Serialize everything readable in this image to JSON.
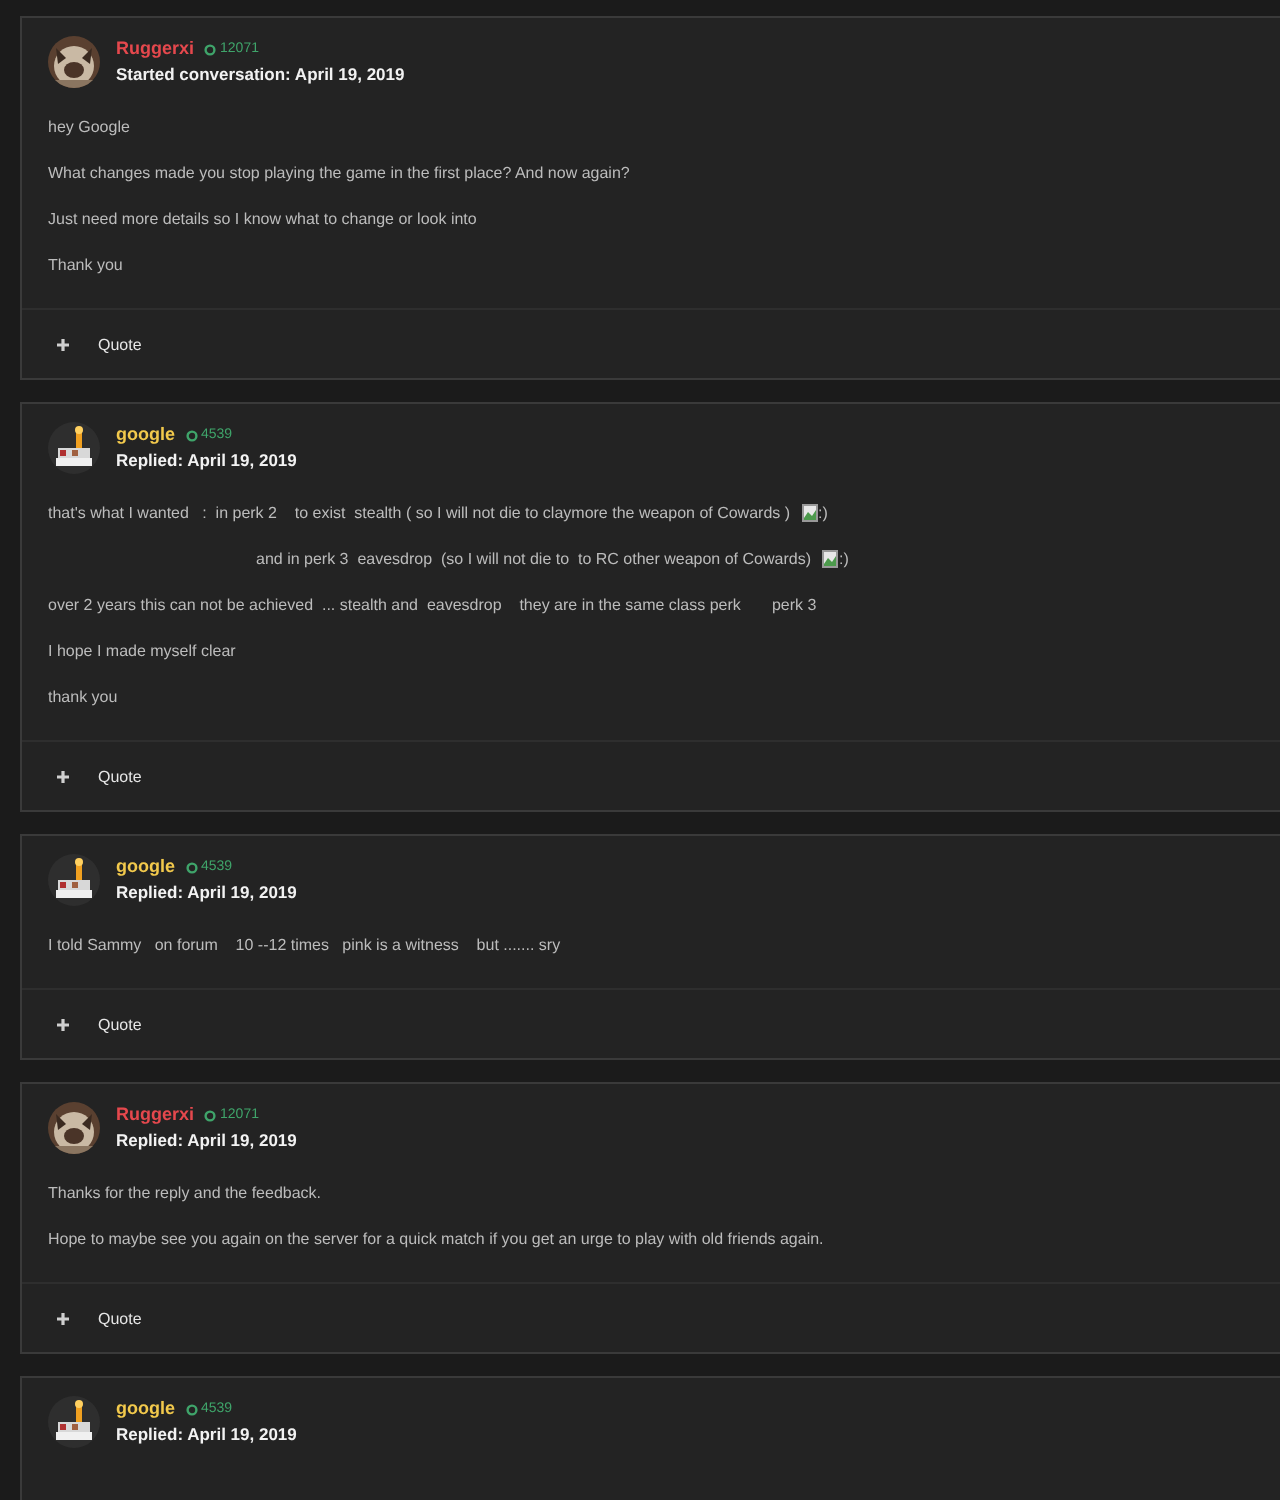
{
  "posts": [
    {
      "author": {
        "name": "Ruggerxi",
        "color": "#e5484d",
        "reputation": "12071"
      },
      "meta": "Started conversation: April 19, 2019",
      "paragraphs": [
        {
          "kind": "plain",
          "text": "hey Google"
        },
        {
          "kind": "plain",
          "text": "What changes made you stop playing the game in the first place? And now again?"
        },
        {
          "kind": "plain",
          "text": "Just need more details so I know what to change or look into"
        },
        {
          "kind": "plain",
          "text": "Thank you"
        }
      ],
      "action": "Quote"
    },
    {
      "author": {
        "name": "google",
        "color": "#f2c94c",
        "reputation": "4539"
      },
      "meta": "Replied: April 19, 2019",
      "paragraphs": [
        {
          "kind": "plain",
          "text": "that's what I wanted   :  in perk 2    to exist  stealth ( so I will not die to claymore the weapon of Cowards )",
          "image_alt": ":)"
        },
        {
          "kind": "indented",
          "text": "and in perk 3  eavesdrop  (so I will not die to  to RC other weapon of Cowards)",
          "image_alt": ":)"
        },
        {
          "kind": "plain",
          "text": "over 2 years this can not be achieved  ... stealth and  eavesdrop    they are in the same class perk       perk 3"
        },
        {
          "kind": "plain",
          "text": "I hope I made myself clear"
        },
        {
          "kind": "plain",
          "text": "thank you"
        }
      ],
      "action": "Quote"
    },
    {
      "author": {
        "name": "google",
        "color": "#f2c94c",
        "reputation": "4539"
      },
      "meta": "Replied: April 19, 2019",
      "paragraphs": [
        {
          "kind": "plain",
          "text": "I told Sammy   on forum    10 --12 times   pink is a witness    but ....... sry"
        }
      ],
      "action": "Quote"
    },
    {
      "author": {
        "name": "Ruggerxi",
        "color": "#e5484d",
        "reputation": "12071"
      },
      "meta": "Replied: April 19, 2019",
      "paragraphs": [
        {
          "kind": "plain",
          "text": "Thanks for the reply and the feedback."
        },
        {
          "kind": "plain",
          "text": "Hope to maybe see you again on the server for a quick match if you get an urge to play with old friends again."
        }
      ],
      "action": "Quote"
    },
    {
      "author": {
        "name": "google",
        "color": "#f2c94c",
        "reputation": "4539"
      },
      "meta": "Replied: April 19, 2019"
    }
  ]
}
